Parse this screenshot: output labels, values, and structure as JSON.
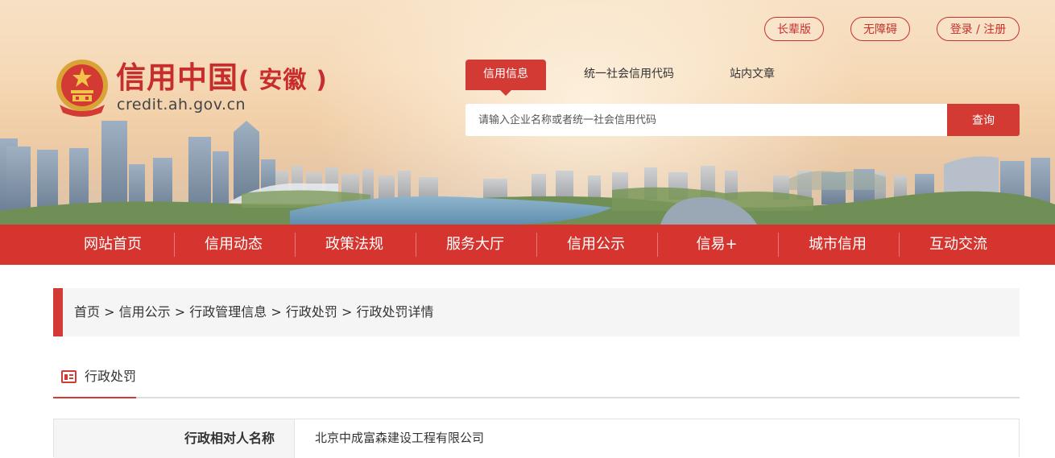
{
  "header": {
    "site_title": "信用中国",
    "site_region": "( 安徽 )",
    "site_url": "credit.ah.gov.cn",
    "top_buttons": {
      "elder": "长辈版",
      "accessibility": "无障碍",
      "login": "登录 / 注册"
    },
    "search_tabs": [
      "信用信息",
      "统一社会信用代码",
      "站内文章"
    ],
    "search": {
      "placeholder": "请输入企业名称或者统一社会信用代码",
      "button": "查询"
    }
  },
  "nav": {
    "items": [
      "网站首页",
      "信用动态",
      "政策法规",
      "服务大厅",
      "信用公示",
      "信易+",
      "城市信用",
      "互动交流"
    ]
  },
  "breadcrumb": {
    "items": [
      "首页",
      "信用公示",
      "行政管理信息",
      "行政处罚",
      "行政处罚详情"
    ],
    "separator": ">"
  },
  "section": {
    "title": "行政处罚"
  },
  "detail": {
    "rows": [
      {
        "label": "行政相对人名称",
        "value": "北京中成富森建设工程有限公司"
      }
    ]
  },
  "colors": {
    "brand_red": "#d23a33",
    "header_bg": "#f6dab8"
  }
}
